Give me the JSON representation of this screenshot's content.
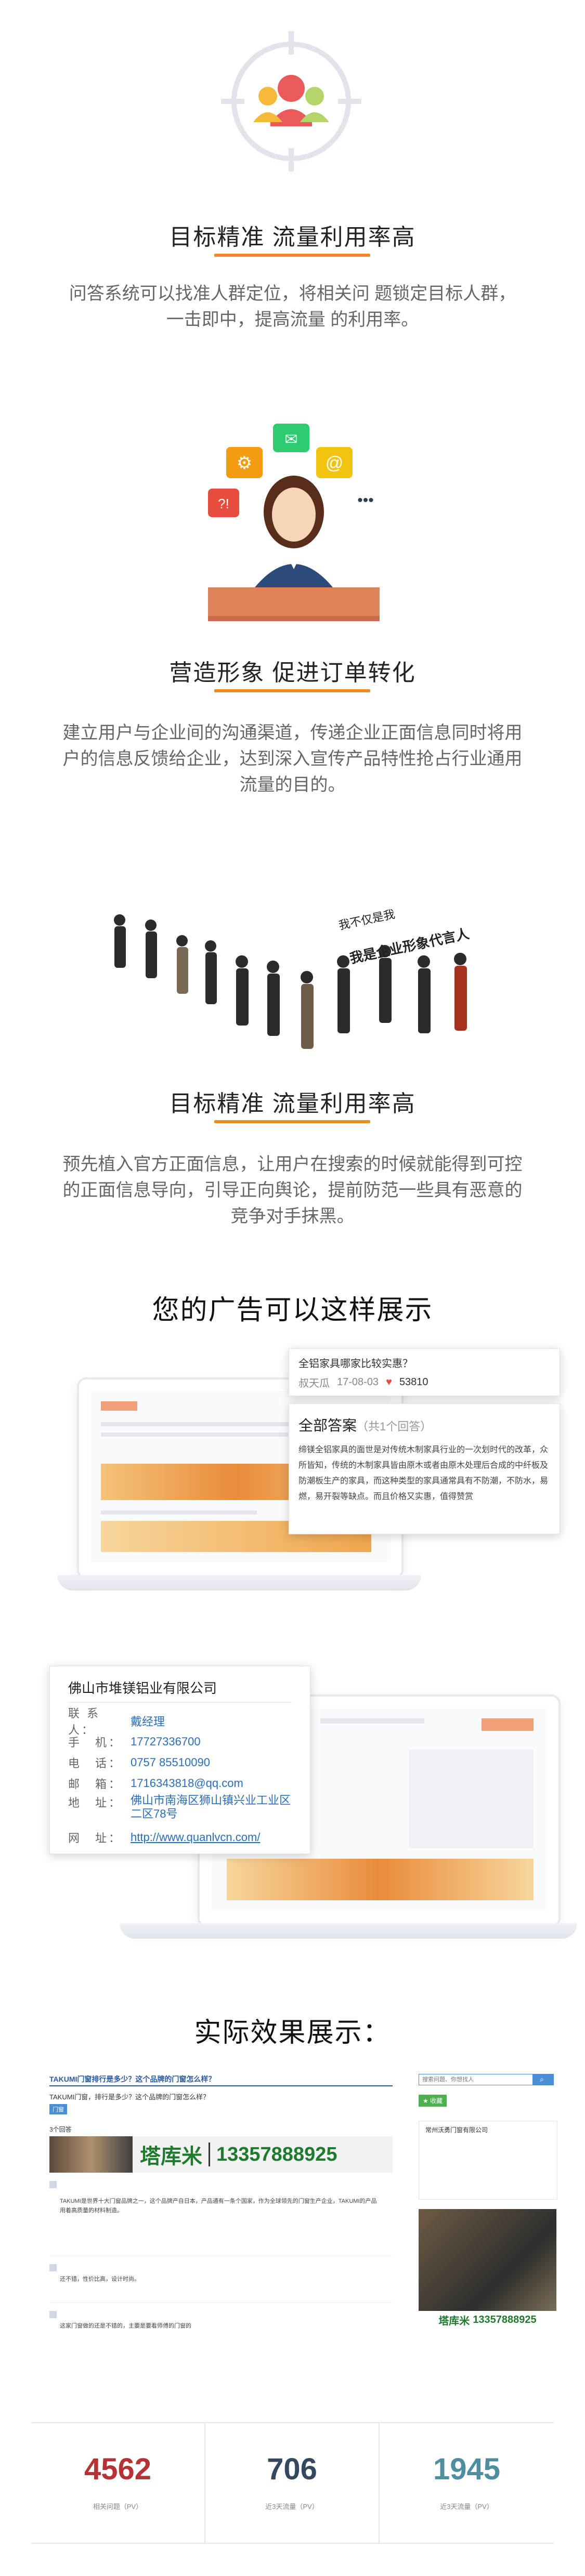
{
  "section1": {
    "title": "目标精准 流量利用率高",
    "desc": "问答系统可以找准人群定位，将相关问 题锁定目标人群，一击即中，提高流量 的利用率。"
  },
  "section2": {
    "title": "营造形象 促进订单转化",
    "desc": "建立用户与企业间的沟通渠道，传递企业正面信息同时将用户的信息反馈给企业，达到深入宣传产品特性抢占行业通用流量的目的。",
    "bubble_icons": [
      "gear-icon",
      "mail-icon",
      "at-icon",
      "chat-icon"
    ]
  },
  "section3": {
    "title": "目标精准 流量利用率高",
    "slogan_line1": "我不仅是我",
    "slogan_line2": "我是企业形象代言人",
    "desc": "预先植入官方正面信息，让用户在搜索的时候就能得到可控的正面信息导向，引导正向舆论，提前防范一些具有恶意的竞争对手抹黑。"
  },
  "ads": {
    "title": "您的广告可以这样展示",
    "question_card": {
      "question": "全铝家具哪家比较实惠？",
      "user": "叔天瓜",
      "date": "17-08-03",
      "likes": "53810"
    },
    "answers_card": {
      "header": "全部答案",
      "count": "（共1个回答）",
      "body": "缔镁全铝家具的面世是对传统木制家具行业的一次划时代的改革，众所皆知，传统的木制家具皆由原木或者由原木处理后合成的中纤板及防潮板生产的家具，而这种类型的家具通常具有不防潮，不防水，易燃，易开裂等缺点。而且价格又实惠，值得赞赏"
    },
    "company_card": {
      "name": "佛山市堆镁铝业有限公司",
      "rows": [
        {
          "k": "联 系 人：",
          "v": "戴经理"
        },
        {
          "k": "手　机：",
          "v": "17727336700"
        },
        {
          "k": "电　话：",
          "v": "0757 85510090"
        },
        {
          "k": "邮　箱：",
          "v": "1716343818@qq.com"
        },
        {
          "k": "地　址：",
          "v": "佛山市南海区狮山镇兴业工业区二区78号"
        },
        {
          "k": "网　址：",
          "v": "http://www.quanlvcn.com/"
        }
      ]
    }
  },
  "effect": {
    "title": "实际效果展示：",
    "question_title": "TAKUMI门窗排行是多少？这个品牌的门窗怎么样？",
    "question_sub": "TAKUMI门窗，排行是多少？这个品牌的门窗怎么样？",
    "tag": "门窗",
    "answers_header": "3个回答",
    "brand_name": "塔库米",
    "brand_phone": "13357888925",
    "answer_text": "TAKUMI是世界十大门窗品牌之一，这个品牌产自日本，产品通有一条个国家，作为全球领先的门窗生产企业，TAKUMI的产品用着高质量的材料制造。",
    "reply2": "还不错，性价比高，设计时尚。",
    "reply3": "这家门窗做的还是不错的，主要是要看师傅的门窗的",
    "search_placeholder": "搜索问题、你想找人",
    "collect_label": "★ 收藏",
    "side_company": "常州沃勇门窗有限公司",
    "side_brand": "塔库米",
    "side_phone": "13357888925"
  },
  "stats": [
    {
      "value": "4562",
      "label": "相关问题（PV）",
      "color": "#b53334"
    },
    {
      "value": "706",
      "label": "近3天流量（PV）",
      "color": "#34495e"
    },
    {
      "value": "1945",
      "label": "近3天流量（PV）",
      "color": "#4e8e9e"
    }
  ]
}
